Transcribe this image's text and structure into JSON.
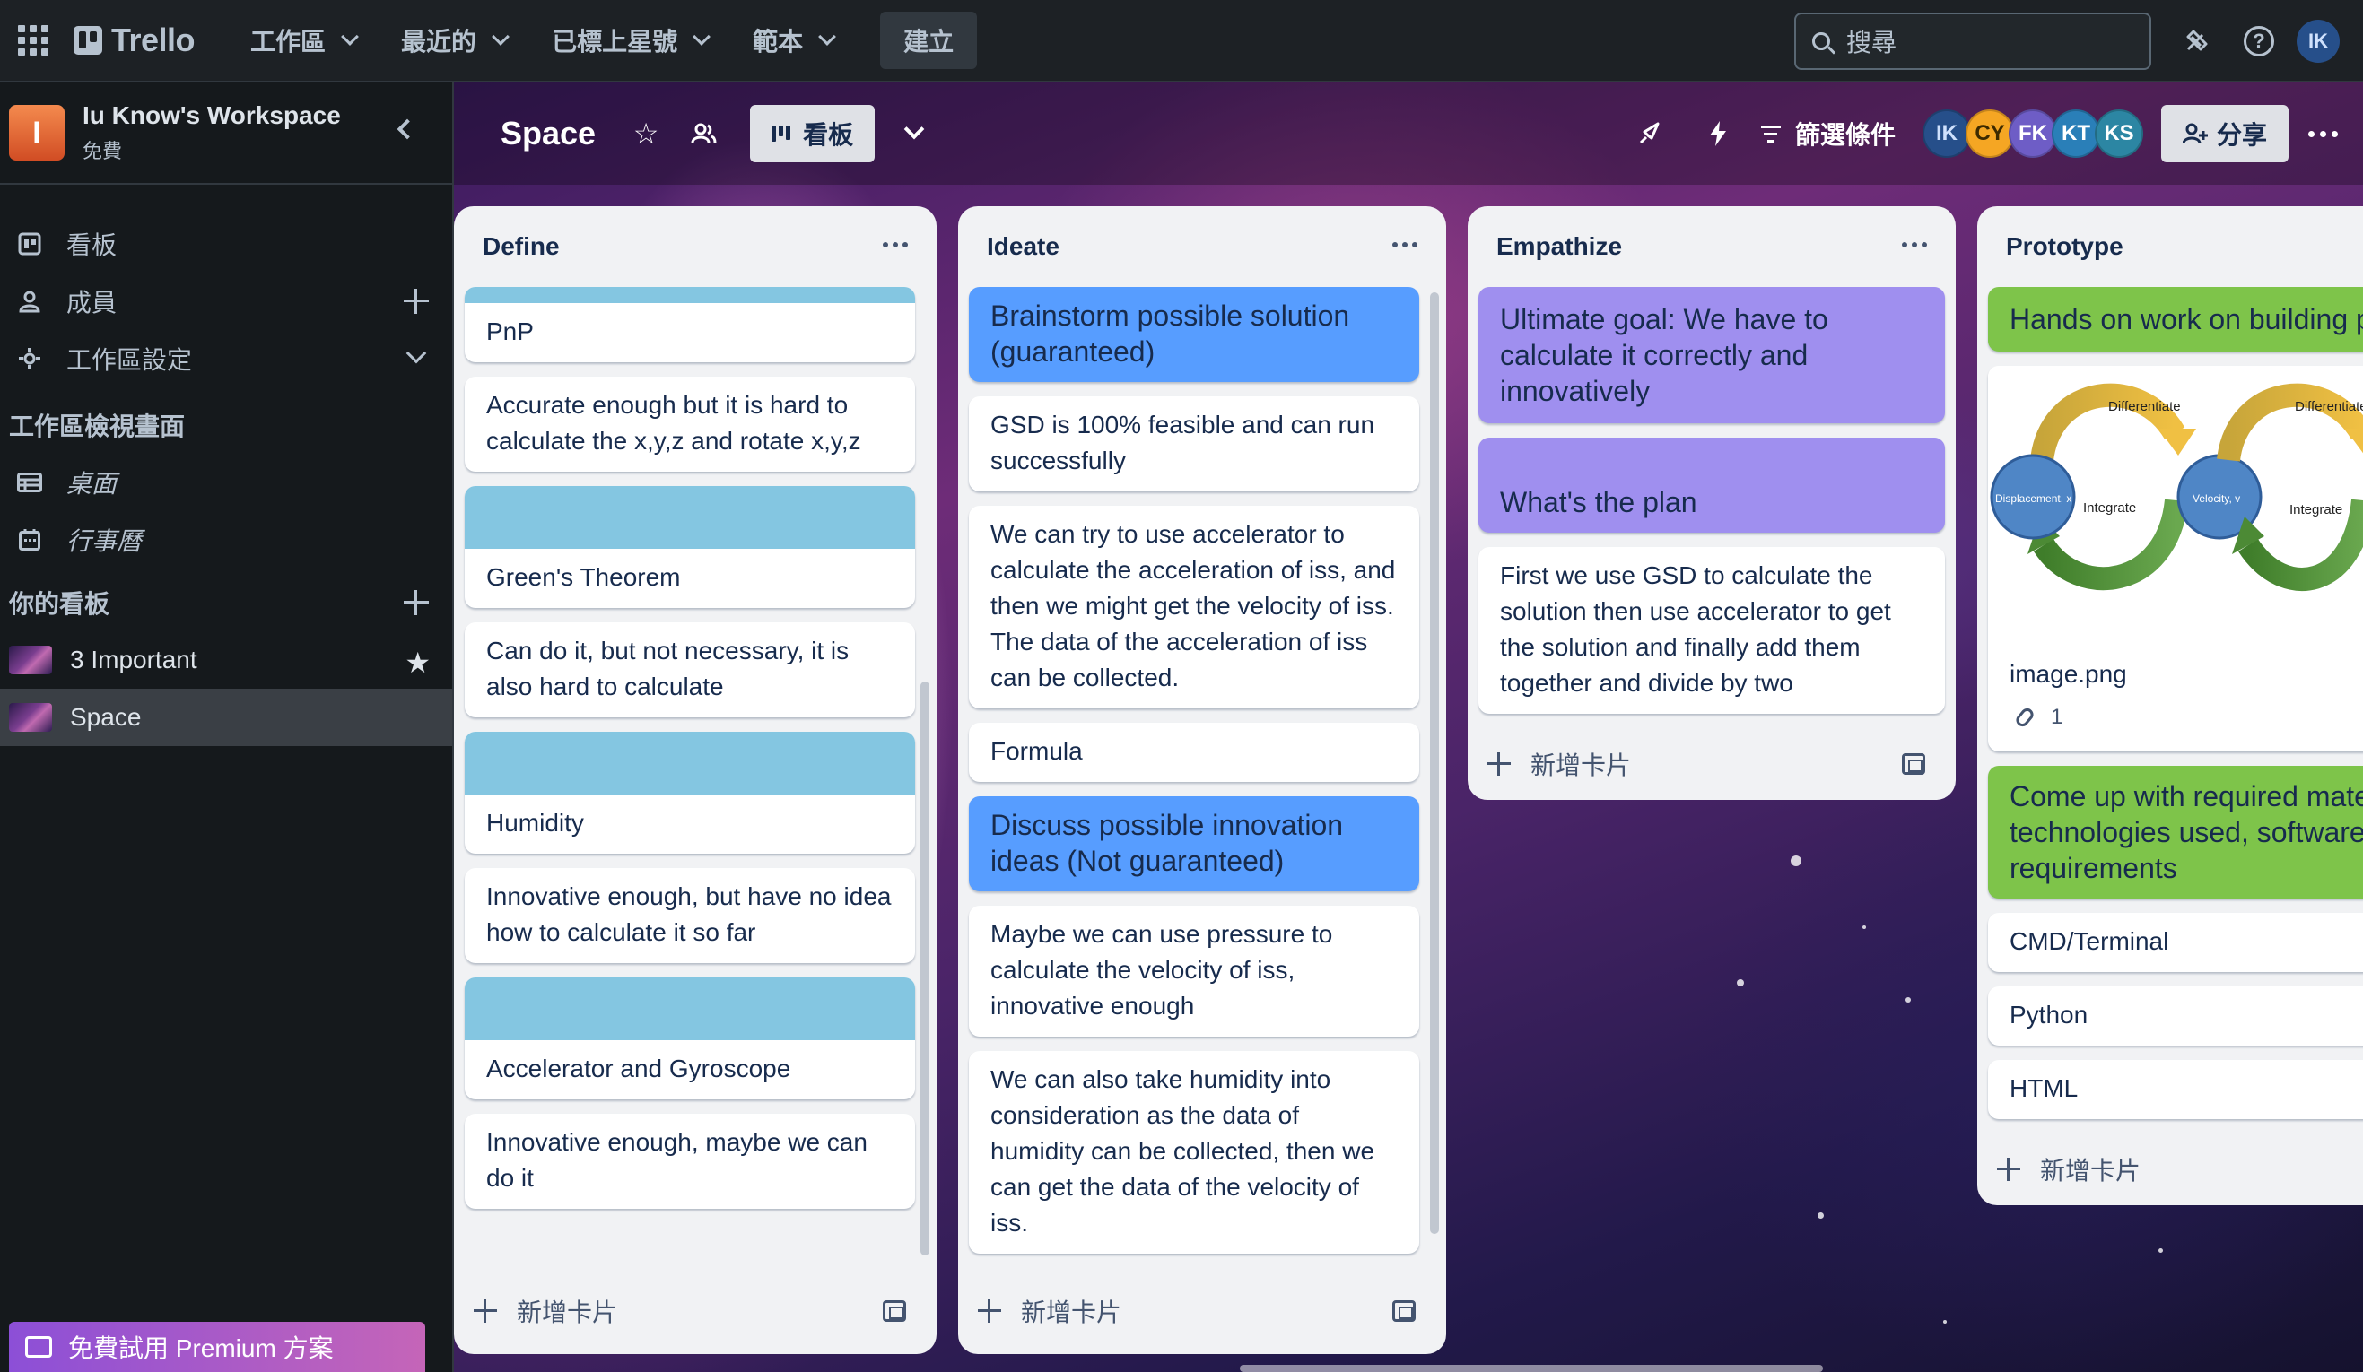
{
  "topbar": {
    "logo": "Trello",
    "menus": [
      "工作區",
      "最近的",
      "已標上星號",
      "範本"
    ],
    "create": "建立",
    "search_placeholder": "搜尋",
    "me_initials": "IK"
  },
  "sidebar": {
    "workspace_initial": "I",
    "workspace_name": "Iu Know's Workspace",
    "workspace_plan": "免費",
    "items": [
      "看板",
      "成員",
      "工作區設定"
    ],
    "views_title": "工作區檢視畫面",
    "views": [
      "桌面",
      "行事曆"
    ],
    "boards_title": "你的看板",
    "boards": [
      "3 Important",
      "Space"
    ],
    "premium": "免費試用 Premium 方案"
  },
  "board": {
    "title": "Space",
    "view_label": "看板",
    "filter_label": "篩選條件",
    "share_label": "分享",
    "members": [
      {
        "initials": "IK",
        "color": "#264f8a"
      },
      {
        "initials": "CY",
        "color": "#f5a623"
      },
      {
        "initials": "FK",
        "color": "#6e5dc6"
      },
      {
        "initials": "KT",
        "color": "#2a7fb8"
      },
      {
        "initials": "KS",
        "color": "#2c86a3"
      }
    ],
    "add_card": "新增卡片"
  },
  "lists": [
    {
      "title": "Define",
      "cards": [
        {
          "text": "PnP",
          "style": "cover-top"
        },
        {
          "text": "Accurate enough but it is hard to calculate the x,y,z and rotate x,y,z",
          "style": "plain"
        },
        {
          "text": "Green's Theorem",
          "style": "cover"
        },
        {
          "text": "Can do it, but not necessary, it is also hard to calculate",
          "style": "plain"
        },
        {
          "text": "Humidity",
          "style": "cover"
        },
        {
          "text": "Innovative enough, but have no idea how to calculate it so far",
          "style": "plain"
        },
        {
          "text": "Accelerator and Gyroscope",
          "style": "cover"
        },
        {
          "text": "Innovative enough, maybe we can do it",
          "style": "plain"
        }
      ]
    },
    {
      "title": "Ideate",
      "cards": [
        {
          "text": "Brainstorm possible solution (guaranteed)",
          "style": "blue"
        },
        {
          "text": "GSD is 100% feasible and can run successfully",
          "style": "plain"
        },
        {
          "text": "We can try to use accelerator to calculate the acceleration of iss, and then we might get the velocity of iss. The data of the acceleration of iss can be collected.",
          "style": "plain"
        },
        {
          "text": "Formula",
          "style": "plain"
        },
        {
          "text": "Discuss possible innovation ideas (Not guaranteed)",
          "style": "blue"
        },
        {
          "text": "Maybe we can use pressure to calculate the velocity of iss, innovative enough",
          "style": "plain"
        },
        {
          "text": "We can also take humidity into consideration as the data of humidity can be collected, then we can get the data of the velocity of iss.",
          "style": "plain"
        }
      ]
    },
    {
      "title": "Empathize",
      "cards": [
        {
          "text": "Ultimate goal: We have to calculate it correctly and innovatively",
          "style": "purple"
        },
        {
          "text": "What's the plan",
          "style": "purple"
        },
        {
          "text": "First we use GSD to calculate the solution then use accelerator to get the solution and finally add them together and divide by two",
          "style": "plain"
        }
      ]
    },
    {
      "title": "Prototype",
      "cards": [
        {
          "text": "Hands on work on building prototype of proof of concept",
          "style": "green"
        },
        {
          "text": "image.png",
          "style": "image",
          "attachments": "1",
          "diagram": {
            "top": "Differentiate",
            "bottom": "Integrate",
            "left": "Displacement, x",
            "right": "Velocity, v"
          }
        },
        {
          "text": "Come up with required materials, technologies used, software, hardware requirements",
          "style": "green"
        },
        {
          "text": "CMD/Terminal",
          "style": "plain"
        },
        {
          "text": "Python",
          "style": "plain"
        },
        {
          "text": "HTML",
          "style": "plain"
        }
      ]
    }
  ]
}
